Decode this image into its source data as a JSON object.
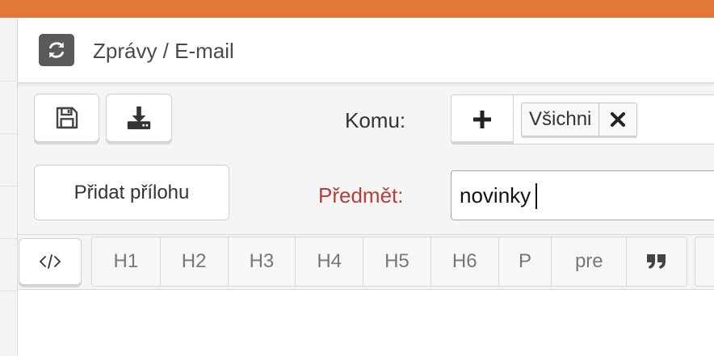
{
  "header": {
    "title": "Zprávy / E-mail"
  },
  "actions": {
    "save_icon": "floppy-disk-icon",
    "download_icon": "download-icon",
    "add_attachment_label": "Přidat přílohu"
  },
  "recipients": {
    "label": "Komu:",
    "add_icon": "plus-icon",
    "tags": [
      {
        "label": "Všichni",
        "remove_icon": "close-icon"
      }
    ]
  },
  "subject": {
    "label": "Předmět:",
    "value": "novinky",
    "label_color": "#b5403a"
  },
  "toolbar": {
    "code_icon": "code-icon",
    "formats": [
      "H1",
      "H2",
      "H3",
      "H4",
      "H5",
      "H6",
      "P",
      "pre"
    ],
    "quote_icon": "quote-icon"
  },
  "colors": {
    "topbar": "#e0783a",
    "refresh_button_bg": "#5a5a5a"
  }
}
